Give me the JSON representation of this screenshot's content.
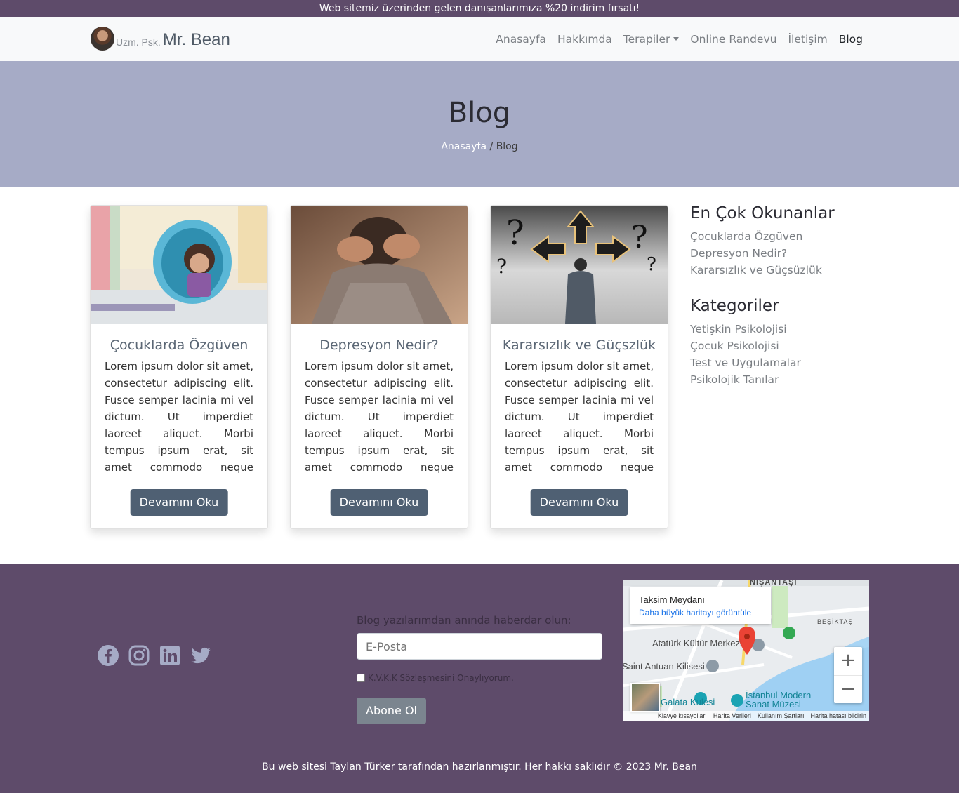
{
  "topbar": {
    "text": "Web sitemiz üzerinden gelen danışanlarımıza %20 indirim fırsatı!"
  },
  "brand": {
    "prefix": "Uzm. Psk.",
    "name": "Mr. Bean"
  },
  "nav": {
    "items": [
      {
        "label": "Anasayfa"
      },
      {
        "label": "Hakkımda"
      },
      {
        "label": "Terapiler"
      },
      {
        "label": "Online Randevu"
      },
      {
        "label": "İletişim"
      },
      {
        "label": "Blog"
      }
    ]
  },
  "hero": {
    "title": "Blog",
    "crumb_home": "Anasayfa",
    "crumb_sep": " / ",
    "crumb_current": "Blog"
  },
  "posts": [
    {
      "title": "Çocuklarda Özgüven",
      "excerpt": "Lorem ipsum dolor sit amet, consectetur adipiscing elit. Fusce semper lacinia mi vel dictum. Ut imperdiet laoreet aliquet. Morbi tempus ipsum erat, sit amet commodo neque feugiat nec...",
      "button": "Devamını Oku"
    },
    {
      "title": "Depresyon Nedir?",
      "excerpt": "Lorem ipsum dolor sit amet, consectetur adipiscing elit. Fusce semper lacinia mi vel dictum. Ut imperdiet laoreet aliquet. Morbi tempus ipsum erat, sit amet commodo neque feugiat nec...",
      "button": "Devamını Oku"
    },
    {
      "title": "Kararsızlık ve Güçszlük",
      "excerpt": "Lorem ipsum dolor sit amet, consectetur adipiscing elit. Fusce semper lacinia mi vel dictum. Ut imperdiet laoreet aliquet. Morbi tempus ipsum erat, sit amet commodo neque feugiat nec...",
      "button": "Devamını Oku"
    }
  ],
  "sidebar": {
    "popular_title": "En Çok Okunanlar",
    "popular": [
      "Çocuklarda Özgüven",
      "Depresyon Nedir?",
      "Kararsızlık ve Güçsüzlük"
    ],
    "categories_title": "Kategoriler",
    "categories": [
      "Yetişkin Psikolojisi",
      "Çocuk Psikolojisi",
      "Test ve Uygulamalar",
      "Psikolojik Tanılar"
    ]
  },
  "footer": {
    "social_icons": [
      "facebook-icon",
      "instagram-icon",
      "linkedin-icon",
      "twitter-icon"
    ],
    "newsletter_label": "Blog yazılarımdan anında haberdar olun:",
    "email_placeholder": "E-Posta",
    "kvkk_label": "K.V.K.K Sözleşmesini Onaylıyorum.",
    "subscribe_label": "Abone Ol",
    "copyright": "Bu web sitesi Taylan Türker tarafından hazırlanmıştır. Her hakkı saklıdır © 2023 Mr. Bean"
  },
  "map": {
    "place": "Taksim Meydanı",
    "larger_map_link": "Daha büyük haritayı görüntüle",
    "labels": [
      "NIŞANTAŞI",
      "BEŞİKTAŞ",
      "Atatürk Kültür Merkezi",
      "Saint Antuan Kilisesi",
      "Galata Kulesi",
      "İstanbul Modern Sanat Müzesi"
    ],
    "zoom_in": "+",
    "zoom_out": "−",
    "footer_links": [
      "Klavye kısayolları",
      "Harita Verileri",
      "Kullanım Şartları",
      "Harita hatası bildirin"
    ]
  },
  "colors": {
    "topbar": "#5e4b6a",
    "hero": "#a6abc6",
    "button": "#4f6073",
    "footer": "#5e4b6a"
  }
}
